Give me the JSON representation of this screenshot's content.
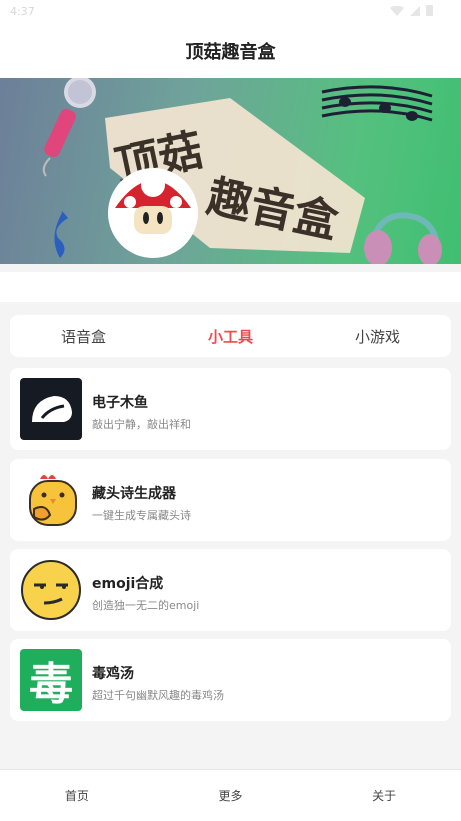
{
  "status_bar": {
    "time": "4:37"
  },
  "header": {
    "title": "顶菇趣音盒"
  },
  "banner": {
    "line1": "顶菇",
    "line2": "趣音盒"
  },
  "tabs": [
    {
      "label": "语音盒",
      "active": false
    },
    {
      "label": "小工具",
      "active": true
    },
    {
      "label": "小游戏",
      "active": false
    }
  ],
  "tools": [
    {
      "title": "电子木鱼",
      "desc": "敲出宁静，敲出祥和",
      "icon": "wooden-fish-icon"
    },
    {
      "title": "藏头诗生成器",
      "desc": "一键生成专属藏头诗",
      "icon": "chick-icon"
    },
    {
      "title": "emoji合成",
      "desc": "创造独一无二的emoji",
      "icon": "emoji-face-icon"
    },
    {
      "title": "毒鸡汤",
      "desc": "超过千句幽默风趣的毒鸡汤",
      "icon": "poison-char-icon",
      "glyph": "毒"
    }
  ],
  "bottom_nav": [
    {
      "label": "首页"
    },
    {
      "label": "更多"
    },
    {
      "label": "关于"
    }
  ],
  "colors": {
    "accent": "#ef4b4b",
    "card_bg": "#ffffff",
    "page_bg": "#f4f4f5",
    "poison_green": "#1fae5c"
  }
}
